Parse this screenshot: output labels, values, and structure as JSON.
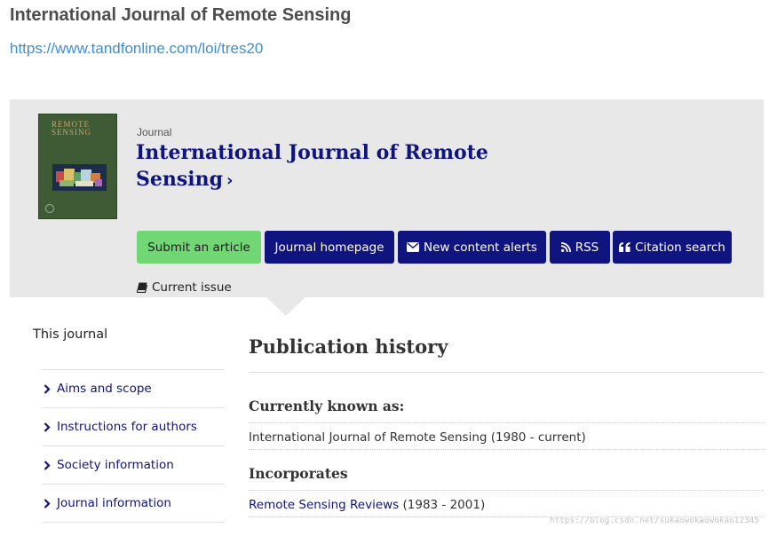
{
  "page": {
    "title": "International Journal of Remote Sensing",
    "url": "https://www.tandfonline.com/loi/tres20"
  },
  "journal": {
    "label": "Journal",
    "title": "International Journal of Remote Sensing",
    "cover_title": "REMOTE SENSING",
    "cover_color": "#3e5b36"
  },
  "actions": {
    "submit": "Submit an article",
    "homepage": "Journal homepage",
    "alerts": "New content alerts",
    "rss": "RSS",
    "citation": "Citation search",
    "current_issue": "Current issue"
  },
  "sidebar": {
    "heading": "This journal",
    "items": [
      {
        "label": "Aims and scope"
      },
      {
        "label": "Instructions for authors"
      },
      {
        "label": "Society information"
      },
      {
        "label": "Journal information"
      }
    ]
  },
  "publication_history": {
    "heading": "Publication history",
    "currently_known_heading": "Currently known as:",
    "currently_known_text": "International Journal of Remote Sensing (1980 - current)",
    "incorporates_heading": "Incorporates",
    "incorporates_link": "Remote Sensing Reviews",
    "incorporates_years": "(1983 - 2001)"
  },
  "watermark": "https://blog.csdn.net/sukaowokaowokao12345",
  "colors": {
    "brand_navy": "#10147e",
    "submit_green": "#71d674",
    "banner_gray": "#e8e8e8",
    "link_blue": "#3d8fd4"
  }
}
